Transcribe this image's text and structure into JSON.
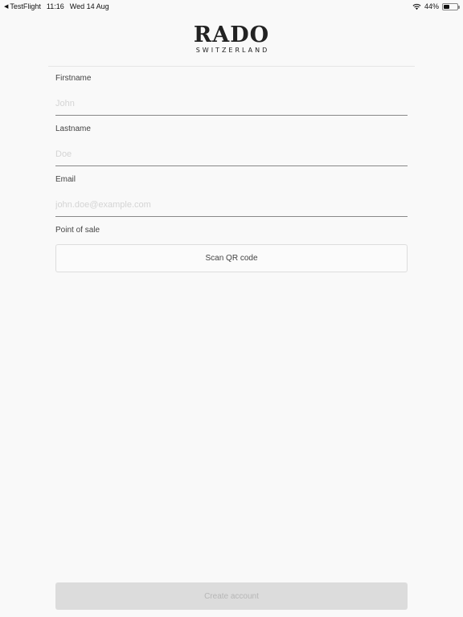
{
  "status_bar": {
    "back_app": "TestFlight",
    "time": "11:16",
    "date": "Wed 14 Aug",
    "battery": "44%",
    "battery_level": 0.44,
    "icons": [
      "back-arrow-icon",
      "wifi-icon",
      "battery-icon"
    ]
  },
  "logo": {
    "name": "RADO",
    "tagline": "SWITZERLAND"
  },
  "form": {
    "firstname": {
      "label": "Firstname",
      "placeholder": "John",
      "value": ""
    },
    "lastname": {
      "label": "Lastname",
      "placeholder": "Doe",
      "value": ""
    },
    "email": {
      "label": "Email",
      "placeholder": "john.doe@example.com",
      "value": ""
    },
    "point_of_sale": {
      "label": "Point of sale",
      "button_label": "Scan QR code"
    },
    "submit_label": "Create account"
  },
  "colors": {
    "background": "#f9f9f9",
    "disabled_button": "#dcdcdc",
    "disabled_text": "#b6b6b6"
  }
}
